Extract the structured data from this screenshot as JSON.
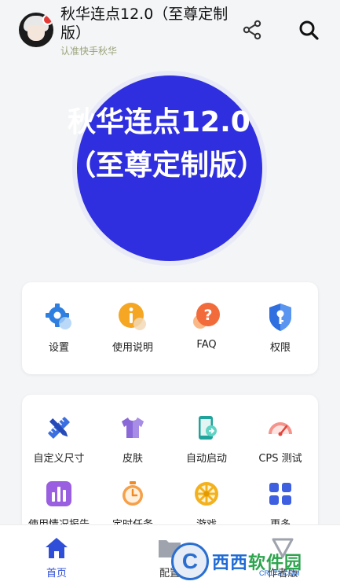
{
  "header": {
    "title": "秋华连点12.0（至尊定制版）",
    "subtitle": "认准快手秋华"
  },
  "banner": {
    "text": "秋华连点12.0（至尊定制版）",
    "circle_color": "#2f2fe0"
  },
  "quick_menu": [
    {
      "label": "设置",
      "icon": "gear-icon"
    },
    {
      "label": "使用说明",
      "icon": "info-icon"
    },
    {
      "label": "FAQ",
      "icon": "question-icon"
    },
    {
      "label": "权限",
      "icon": "shield-key-icon"
    }
  ],
  "tools": [
    {
      "label": "自定义尺寸",
      "icon": "ruler-pencil-icon"
    },
    {
      "label": "皮肤",
      "icon": "tshirt-icon"
    },
    {
      "label": "自动启动",
      "icon": "phone-link-icon"
    },
    {
      "label": "CPS 测试",
      "icon": "speedometer-icon"
    },
    {
      "label": "使用情况报告",
      "icon": "bar-chart-icon"
    },
    {
      "label": "定时任务",
      "icon": "stopwatch-icon"
    },
    {
      "label": "游戏",
      "icon": "wheel-icon"
    },
    {
      "label": "更多",
      "icon": "grid-icon"
    }
  ],
  "bottom_nav": [
    {
      "label": "首页",
      "icon": "home-icon",
      "active": true
    },
    {
      "label": "配置",
      "icon": "folder-icon",
      "active": false
    },
    {
      "label": "作者版",
      "icon": "diamond-icon",
      "active": false
    }
  ],
  "watermark": {
    "letter": "C",
    "text_part1": "西西",
    "text_part2": "软件园",
    "url": "CR173.COM"
  },
  "colors": {
    "accent": "#2f4fd8",
    "background": "#f4f5f7"
  }
}
